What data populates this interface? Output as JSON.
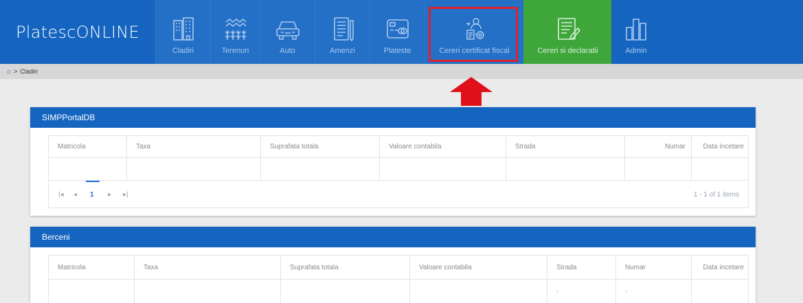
{
  "app": {
    "logo": "PlatescONLINE"
  },
  "nav": {
    "items": [
      {
        "label": "Cladiri",
        "icon": "building-icon"
      },
      {
        "label": "Terenuri",
        "icon": "field-icon"
      },
      {
        "label": "Auto",
        "icon": "car-icon"
      },
      {
        "label": "Amenzi",
        "icon": "document-icon"
      },
      {
        "label": "Plateste",
        "icon": "card-icon"
      },
      {
        "label": "Cereri certificat fiscal",
        "icon": "certificate-icon"
      },
      {
        "label": "Cereri si declaratii",
        "icon": "form-edit-icon"
      },
      {
        "label": "Admin",
        "icon": "bar-chart-icon"
      }
    ],
    "highlight_color": "#e0202a",
    "accent_green": "#3fa63c",
    "brand_blue": "#1565c0"
  },
  "breadcrumb": {
    "home_icon": "home-icon",
    "separator": ">",
    "current": "Cladiri"
  },
  "panels": [
    {
      "title": "SIMPPortalDB",
      "columns": [
        "Matricola",
        "Taxa",
        "Suprafata totala",
        "Valoare contabila",
        "Strada",
        "Numar",
        "Data incetare"
      ],
      "rows": [
        [
          "",
          "",
          "",
          "",
          "",
          "",
          ""
        ]
      ],
      "pager": {
        "first": "|◂",
        "prev": "◂",
        "page": "1",
        "next": "▸",
        "last": "▸|",
        "summary": "1 - 1 of 1 items"
      }
    },
    {
      "title": "Berceni",
      "columns": [
        "Matricola",
        "Taxa",
        "Suprafata totala",
        "Valoare contabila",
        "Strada",
        "Numar",
        "Data incetare"
      ],
      "rows": [
        [
          "",
          "",
          "",
          "",
          "-",
          "-",
          ""
        ]
      ]
    }
  ]
}
